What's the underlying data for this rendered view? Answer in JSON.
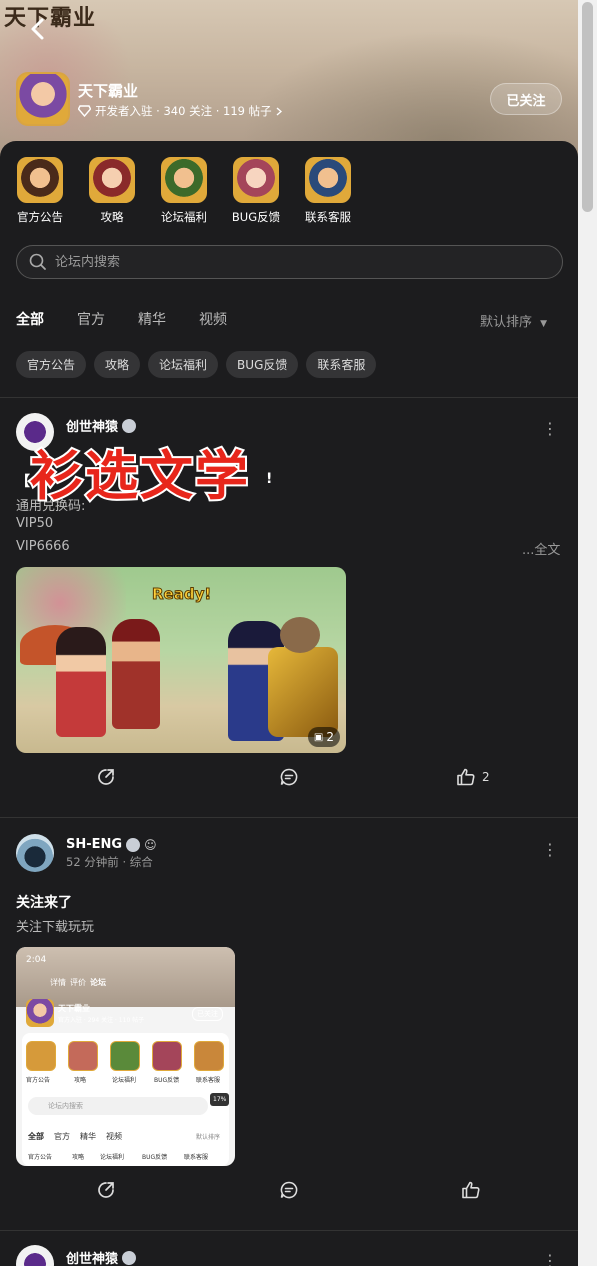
{
  "header": {
    "logo_text": "天下霸业",
    "game_name": "天下霸业",
    "meta": "开发者入驻 · 340 关注 · 119 帖子",
    "follow_label": "已关注"
  },
  "shortcuts": [
    {
      "label": "官方公告",
      "color": "#d69a3a"
    },
    {
      "label": "攻略",
      "color": "#c46a5a"
    },
    {
      "label": "论坛福利",
      "color": "#5a8a3a"
    },
    {
      "label": "BUG反馈",
      "color": "#a4455a"
    },
    {
      "label": "联系客服",
      "color": "#c9873a"
    }
  ],
  "search": {
    "placeholder": "论坛内搜索"
  },
  "tabs": [
    "全部",
    "官方",
    "精华",
    "视频"
  ],
  "sort_label": "默认排序",
  "chips": [
    "官方公告",
    "攻略",
    "论坛福利",
    "BUG反馈",
    "联系客服"
  ],
  "posts": [
    {
      "author": "创世神猿",
      "title_fragment": "【",
      "title_end": "!",
      "line1": "通用兑换码:",
      "line2": "VIP50",
      "line3": "VIP6666",
      "full_label": "...全文",
      "image_count": "2",
      "like_count": "2",
      "image_text": "Ready!"
    },
    {
      "author": "SH-ENG",
      "meta": "52 分钟前 · 综合",
      "title": "关注来了",
      "body": "关注下载玩玩",
      "like_count": ""
    },
    {
      "author": "创世神猿"
    }
  ],
  "screenshot": {
    "time": "2:04",
    "tabs": [
      "详情",
      "评价",
      "论坛"
    ],
    "game_name": "天下霸业",
    "meta": "官方入驻 · 294 关注 · 110 帖子",
    "follow": "已关注",
    "icons": [
      "官方公告",
      "攻略",
      "论坛福利",
      "BUG反馈",
      "联系客服"
    ],
    "search": "论坛内搜索",
    "percent": "17%",
    "tabs2": [
      "全部",
      "官方",
      "精华",
      "视频"
    ],
    "sort": "默认排序",
    "chips": [
      "官方公告",
      "攻略",
      "论坛福利",
      "BUG反馈",
      "联系客服"
    ]
  },
  "watermark": "衫选文学",
  "colors": {
    "accent": "#2ec5a8",
    "background": "#1c1c1e",
    "watermark": "#e8261b"
  }
}
